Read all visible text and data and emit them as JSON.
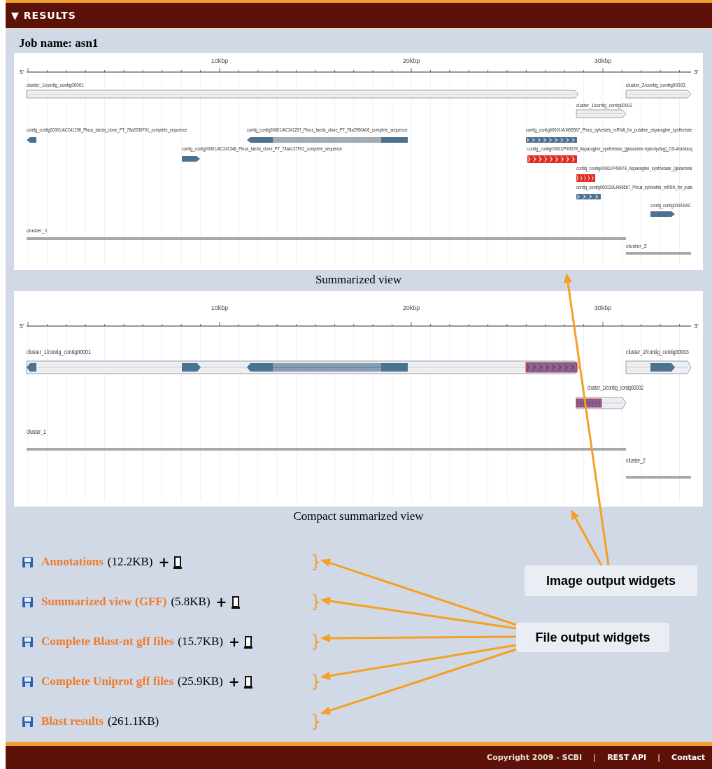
{
  "header": {
    "toggle": "▼",
    "title": "RESULTS"
  },
  "job": "Job name: asn1",
  "views": [
    {
      "caption": "Summarized view",
      "ticks": [
        "10kbp",
        "20kbp",
        "30kbp"
      ],
      "ends": [
        "5'",
        "3'"
      ],
      "tracks": [
        {
          "kind": "contig",
          "label": "cluster_1/contig_contig00001"
        },
        {
          "kind": "contig",
          "label": "cluster_2/contig_contig00003"
        },
        {
          "kind": "contig",
          "label": "cluster_1/contig_contig00002"
        },
        {
          "kind": "hit",
          "color": "#4d7190",
          "label": "contig_contig00001/AC241296_Pinus_taeda_clone_PT_78a2030F01_complete_sequence"
        },
        {
          "kind": "hit",
          "color": "#4d7190",
          "label": "contig_contig00001/AC241297_Pinus_taeda_clone_PT_78a2950A06_complete_sequence"
        },
        {
          "kind": "hit",
          "color": "#4d7190",
          "label": "contig_contig00001/AJ496567_Pinus_sylvestris_mRNA_for_putative_asparagine_synthetase"
        },
        {
          "kind": "hit",
          "color": "#4d7190",
          "label": "contig_contig00001/AC241348_Pinus_taeda_clone_PT_78a4137F02_complete_sequence"
        },
        {
          "kind": "hit",
          "color": "#e8291c",
          "label": "contig_contig00001/P49078_Asparagine_synthetase_[glutamine-hydrolyzing]_OS-Arabidoq"
        },
        {
          "kind": "hit",
          "color": "#e8291c",
          "label": "contig_contig00002/P49078_Asparagine_synthetase_[glutamine"
        },
        {
          "kind": "hit",
          "color": "#4d7190",
          "label": "contig_contig00002/AJ496567_Pinus_sylvestris_mRNA_for_puta"
        },
        {
          "kind": "hit",
          "color": "#4d7190",
          "label": "contig_contig00003/AC"
        },
        {
          "kind": "cluster",
          "label": "cluster_1"
        },
        {
          "kind": "cluster",
          "label": "cluster_2"
        }
      ]
    },
    {
      "caption": "Compact summarized view",
      "ticks": [
        "10kbp",
        "20kbp",
        "30kbp"
      ],
      "ends": [
        "5'",
        "3'"
      ],
      "tracks": [
        {
          "kind": "contig",
          "label": "cluster_1/contig_contig00001"
        },
        {
          "kind": "contig",
          "label": "cluster_2/contig_contig00003"
        },
        {
          "kind": "contig",
          "label": "cluster_1/contig_contig00002"
        },
        {
          "kind": "cluster",
          "label": "cluster_1"
        },
        {
          "kind": "cluster",
          "label": "cluster_2"
        }
      ]
    }
  ],
  "files": [
    {
      "name": "Annotations",
      "size": "(12.2KB)",
      "add": "+",
      "bracket": "}"
    },
    {
      "name": "Summarized view (GFF)",
      "size": "(5.8KB)",
      "add": "+",
      "bracket": "}"
    },
    {
      "name": "Complete Blast-nt gff files",
      "size": "(15.7KB)",
      "add": "+",
      "bracket": "}"
    },
    {
      "name": "Complete Uniprot gff files",
      "size": "(25.9KB)",
      "add": "+",
      "bracket": "}"
    },
    {
      "name": "Blast results",
      "size": "(261.1KB)",
      "bracket": "}"
    }
  ],
  "callouts": [
    {
      "text": "Image output widgets"
    },
    {
      "text": "File output widgets"
    }
  ],
  "footer": [
    {
      "kind": "text",
      "text": "Copyright 2009 - SCBI"
    },
    {
      "kind": "sep",
      "text": "|"
    },
    {
      "kind": "link",
      "text": "REST API"
    },
    {
      "kind": "sep",
      "text": "|"
    },
    {
      "kind": "link",
      "text": "Contact"
    }
  ]
}
